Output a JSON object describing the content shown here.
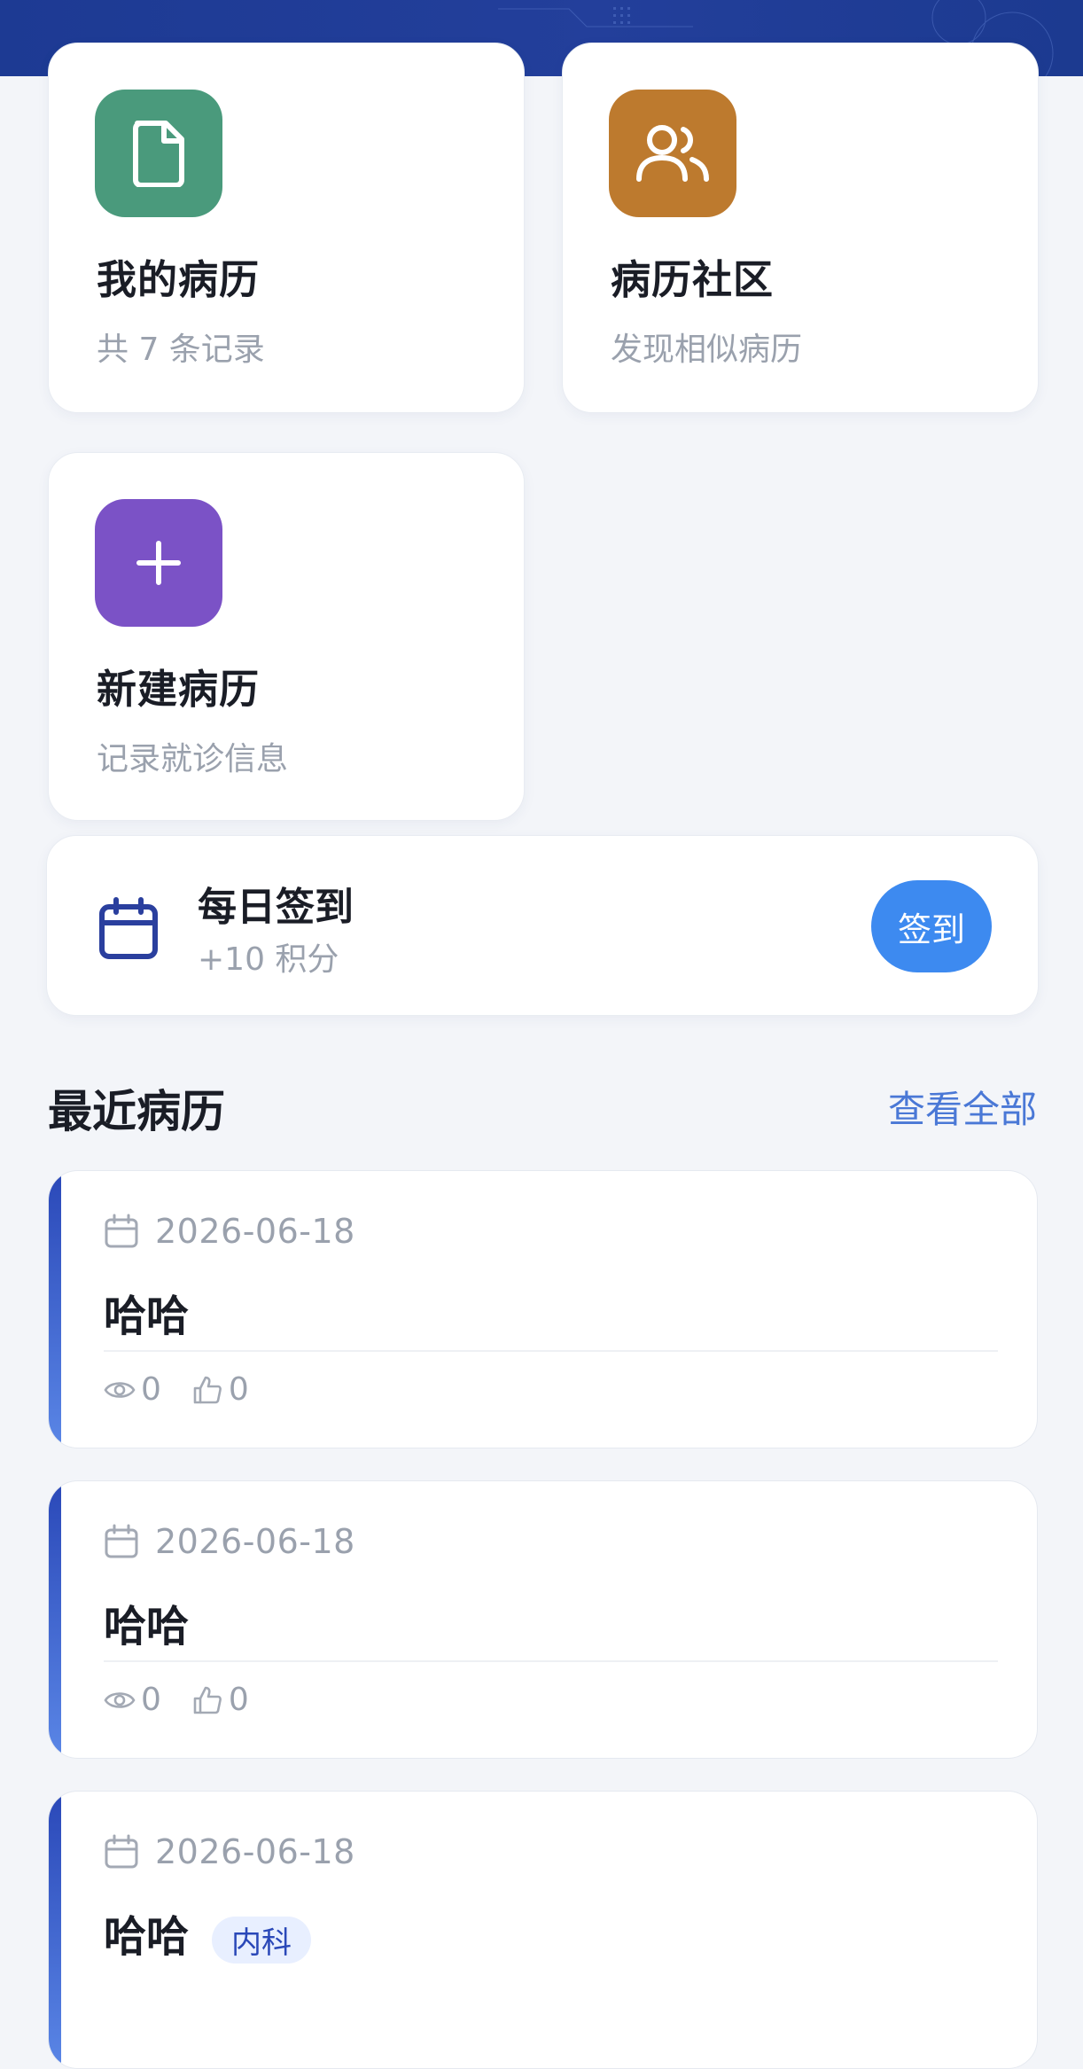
{
  "features": {
    "my_records": {
      "title": "我的病历",
      "subtitle": "共 7 条记录",
      "icon": "file-icon",
      "color": "#4a9a7c"
    },
    "community": {
      "title": "病历社区",
      "subtitle": "发现相似病历",
      "icon": "users-icon",
      "color": "#bd7a2e"
    },
    "new_record": {
      "title": "新建病历",
      "subtitle": "记录就诊信息",
      "icon": "plus-icon",
      "color": "#7b52c6"
    }
  },
  "checkin": {
    "title": "每日签到",
    "subtitle": "+10 积分",
    "button": "签到"
  },
  "recent": {
    "title": "最近病历",
    "view_all": "查看全部",
    "items": [
      {
        "date": "2026-06-18",
        "title": "哈哈",
        "views": "0",
        "likes": "0"
      },
      {
        "date": "2026-06-18",
        "title": "哈哈",
        "views": "0",
        "likes": "0"
      },
      {
        "date": "2026-06-18",
        "title": "哈哈",
        "tag": "内科"
      }
    ]
  }
}
